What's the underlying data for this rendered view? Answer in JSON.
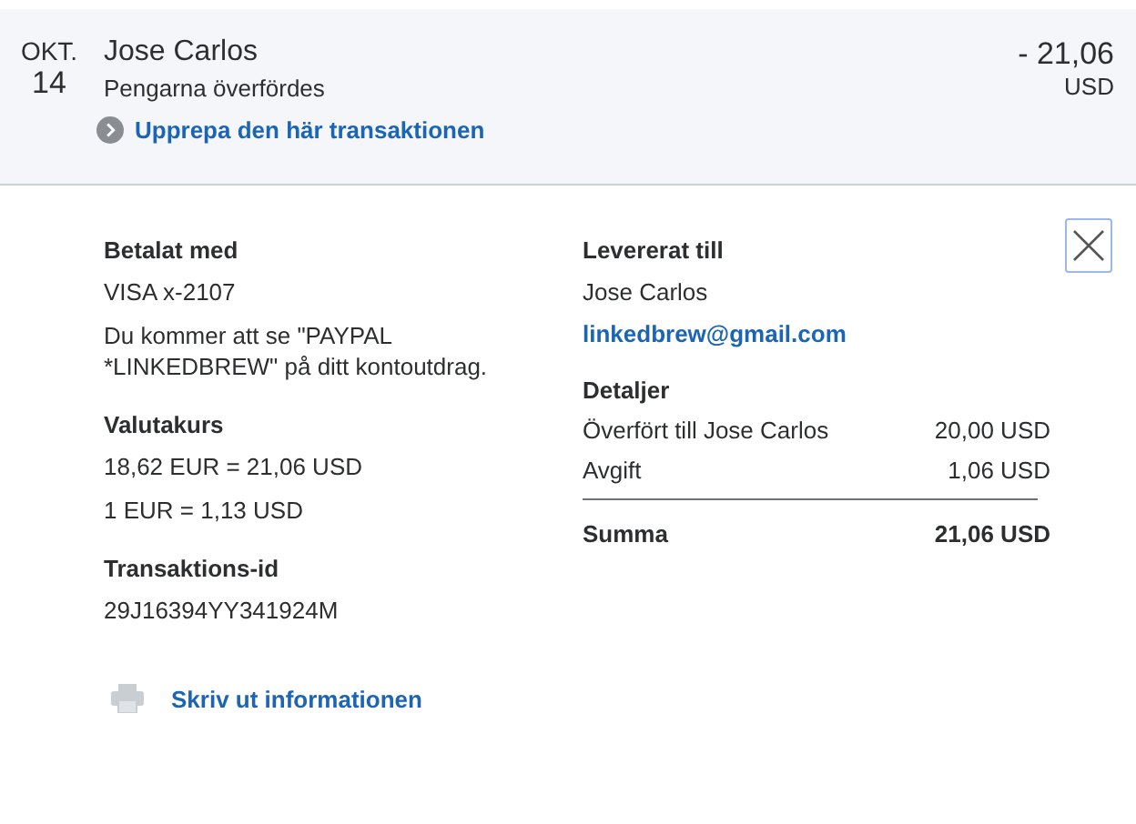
{
  "header": {
    "month": "OKT.",
    "day": "14",
    "name": "Jose Carlos",
    "status": "Pengarna överfördes",
    "repeat_link": "Upprepa den här transaktionen",
    "amount": "- 21,06",
    "currency": "USD"
  },
  "left": [
    {
      "heading": "Betalat med",
      "lines": [
        "VISA x-2107",
        "Du kommer att se \"PAYPAL *LINKEDBREW\" på ditt kontoutdrag."
      ]
    },
    {
      "heading": "Valutakurs",
      "lines": [
        "18,62 EUR = 21,06 USD",
        "1 EUR = 1,13 USD"
      ]
    },
    {
      "heading": "Transaktions-id",
      "lines": [
        "29J16394YY341924M"
      ]
    }
  ],
  "delivered": {
    "heading": "Levererat till",
    "name": "Jose Carlos",
    "email": "linkedbrew@gmail.com"
  },
  "details": {
    "heading": "Detaljer",
    "rows": [
      {
        "label": "Överfört till Jose Carlos",
        "value": "20,00 USD"
      },
      {
        "label": "Avgift",
        "value": "1,06 USD"
      }
    ],
    "total": {
      "label": "Summa",
      "value": "21,06 USD"
    }
  },
  "print_link": "Skriv ut informationen"
}
